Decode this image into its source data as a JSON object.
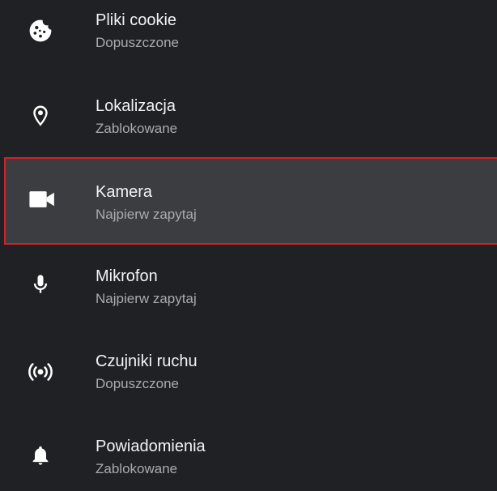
{
  "settings": {
    "items": [
      {
        "icon": "cookie-icon",
        "title": "Pliki cookie",
        "status": "Dopuszczone",
        "selected": false
      },
      {
        "icon": "location-pin-icon",
        "title": "Lokalizacja",
        "status": "Zablokowane",
        "selected": false
      },
      {
        "icon": "camera-icon",
        "title": "Kamera",
        "status": "Najpierw zapytaj",
        "selected": true
      },
      {
        "icon": "microphone-icon",
        "title": "Mikrofon",
        "status": "Najpierw zapytaj",
        "selected": false
      },
      {
        "icon": "motion-sensors-icon",
        "title": "Czujniki ruchu",
        "status": "Dopuszczone",
        "selected": false
      },
      {
        "icon": "notifications-bell-icon",
        "title": "Powiadomienia",
        "status": "Zablokowane",
        "selected": false
      }
    ]
  },
  "colors": {
    "background": "#202124",
    "selected_background": "#3c3d41",
    "focus_border": "#d3222a",
    "title_text": "#f1f3f4",
    "status_text": "#a8abaf"
  }
}
